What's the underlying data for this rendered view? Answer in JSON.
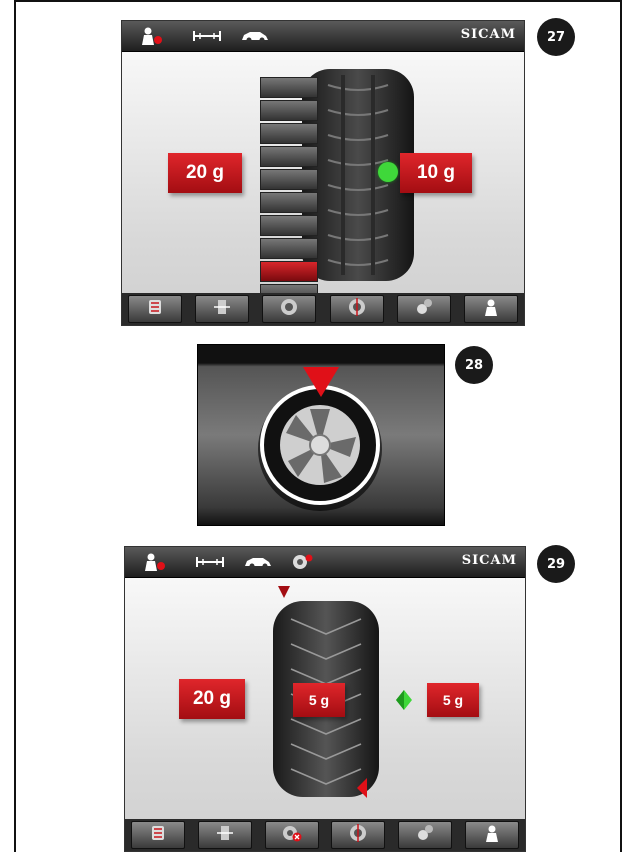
{
  "figures": [
    {
      "number": "27",
      "brand": "SICAM",
      "left_weight": "20 g",
      "right_weight": "10 g",
      "indicator_color": "#3fd83a"
    },
    {
      "number": "28",
      "indicator_color": "#e01018"
    },
    {
      "number": "29",
      "brand": "SICAM",
      "left_weight": "20 g",
      "center_weight": "5 g",
      "right_weight": "5 g",
      "indicator_color": "#3fd83a"
    }
  ],
  "colors": {
    "accent_red": "#c8141b",
    "toolbar_dark": "#2a2a2a"
  },
  "icons": {
    "topbar_fig27": [
      "operator-icon",
      "wheel-dimensions-icon",
      "car-icon"
    ],
    "topbar_fig29": [
      "operator-icon",
      "wheel-dimensions-icon",
      "car-icon",
      "wheel-balance-program-icon"
    ],
    "bottombar_fig27": [
      "tire-select-icon",
      "rim-width-icon",
      "wheel-icon",
      "wheel-position-icon",
      "settings-icon",
      "user-icon"
    ],
    "bottombar_fig29": [
      "tire-select-icon",
      "rim-width-icon",
      "wheel-cancel-icon",
      "wheel-position-icon",
      "settings-icon",
      "user-icon"
    ]
  }
}
